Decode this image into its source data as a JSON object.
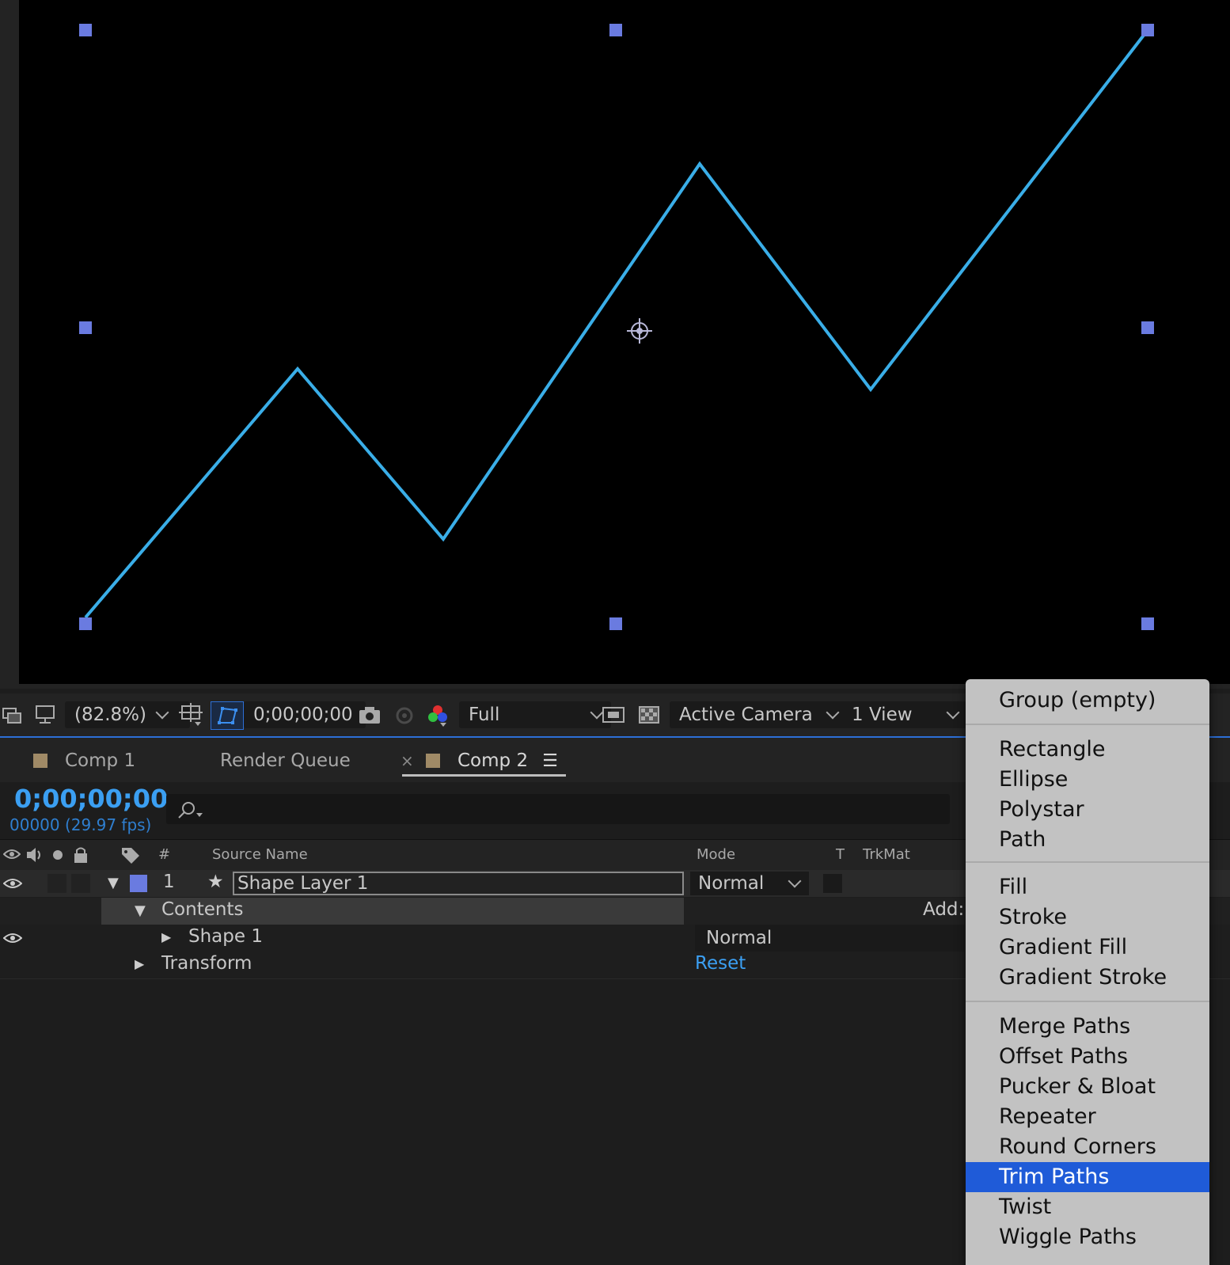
{
  "viewer": {
    "zoom": "(82.8%)",
    "timecode": "0;00;00;00",
    "resolution": "Full",
    "camera": "Active Camera",
    "view_layout": "1 View",
    "path_color": "#3aaee8",
    "handle_color": "#6a7be0"
  },
  "tabs": [
    {
      "label": "Comp 1"
    },
    {
      "label": "Render Queue"
    },
    {
      "label": "Comp 2",
      "active": true
    }
  ],
  "timeline": {
    "timecode": "0;00;00;00",
    "frame_info": "00000 (29.97 fps)",
    "columns": {
      "number": "#",
      "source_name": "Source Name",
      "mode": "Mode",
      "t": "T",
      "trkmat": "TrkMat"
    },
    "layer": {
      "index": "1",
      "name": "Shape Layer 1",
      "mode": "Normal",
      "label_color": "#6a7be0"
    },
    "contents_label": "Contents",
    "add_label": "Add:",
    "shape_label": "Shape 1",
    "shape_mode": "Normal",
    "transform_label": "Transform",
    "reset_label": "Reset"
  },
  "menu": {
    "items": [
      "Group (empty)",
      "Rectangle",
      "Ellipse",
      "Polystar",
      "Path",
      "Fill",
      "Stroke",
      "Gradient Fill",
      "Gradient Stroke",
      "Merge Paths",
      "Offset Paths",
      "Pucker & Bloat",
      "Repeater",
      "Round Corners",
      "Trim Paths",
      "Twist",
      "Wiggle Paths"
    ],
    "selected": "Trim Paths"
  }
}
